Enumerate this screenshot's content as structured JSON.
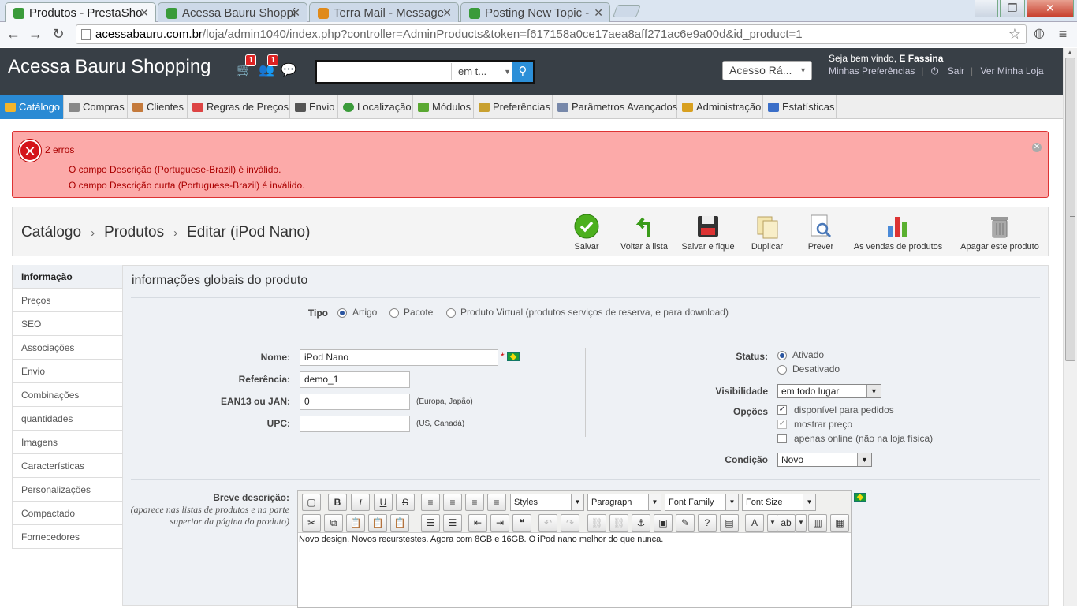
{
  "browser": {
    "tabs": [
      {
        "title": "Produtos - PrestaSho",
        "color": "#3a9b3a",
        "active": true
      },
      {
        "title": "Acessa Bauru Shoppi",
        "color": "#3a9b3a",
        "active": false
      },
      {
        "title": "Terra Mail - Message",
        "color": "#e08a1b",
        "active": false
      },
      {
        "title": "Posting New Topic -",
        "color": "#3a9b3a",
        "active": false
      }
    ],
    "url_host": "acessabauru.com.br",
    "url_path": "/loja/admin1040/index.php?controller=AdminProducts&token=f617158a0ce17aea8aff271ac6e9a00d&id_product=1"
  },
  "header": {
    "shop_name": "Acessa Bauru Shopping",
    "badges": {
      "orders": "1",
      "customers": "1"
    },
    "search_placeholder": "",
    "search_scope": "em t...",
    "quick_access": "Acesso Rá...",
    "welcome_prefix": "Seja bem vindo,",
    "user_name": "E Fassina",
    "links": {
      "prefs": "Minhas Preferências",
      "logout": "Sair",
      "view_shop": "Ver Minha Loja"
    }
  },
  "menu": [
    {
      "label": "Catálogo",
      "color": "#f3b52b"
    },
    {
      "label": "Compras",
      "color": "#777"
    },
    {
      "label": "Clientes",
      "color": "#c47a3c"
    },
    {
      "label": "Regras de Preços",
      "color": "#d44"
    },
    {
      "label": "Envio",
      "color": "#555"
    },
    {
      "label": "Localização",
      "color": "#3a9b3a"
    },
    {
      "label": "Módulos",
      "color": "#5aa832"
    },
    {
      "label": "Preferências",
      "color": "#c8a030"
    },
    {
      "label": "Parâmetros Avançados",
      "color": "#7788aa"
    },
    {
      "label": "Administração",
      "color": "#d8a020"
    },
    {
      "label": "Estatísticas",
      "color": "#3a6ec8"
    }
  ],
  "errors": {
    "count": "2 erros",
    "lines": [
      "O campo Descrição (Portuguese-Brazil) é inválido.",
      "O campo Descrição curta (Portuguese-Brazil) é inválido."
    ]
  },
  "breadcrumb": {
    "level1": "Catálogo",
    "level2": "Produtos",
    "level3": "Editar (iPod Nano)"
  },
  "toolbar": {
    "save": "Salvar",
    "back": "Voltar à lista",
    "save_stay": "Salvar e fique",
    "duplicate": "Duplicar",
    "preview": "Prever",
    "sales": "As vendas de produtos",
    "delete": "Apagar este produto"
  },
  "product_tabs": [
    "Informação",
    "Preços",
    "SEO",
    "Associações",
    "Envio",
    "Combinações",
    "quantidades",
    "Imagens",
    "Características",
    "Personalizações",
    "Compactado",
    "Fornecedores"
  ],
  "form": {
    "title": "informações globais do produto",
    "type_label": "Tipo",
    "type_options": [
      "Artigo",
      "Pacote",
      "Produto Virtual (produtos serviços de reserva, e para download)"
    ],
    "name_label": "Nome:",
    "name_value": "iPod Nano",
    "required_mark": "*",
    "ref_label": "Referência:",
    "ref_value": "demo_1",
    "ean_label": "EAN13 ou JAN:",
    "ean_value": "0",
    "ean_hint": "(Europa, Japão)",
    "upc_label": "UPC:",
    "upc_value": "",
    "upc_hint": "(US, Canadá)",
    "status_label": "Status:",
    "status_on": "Ativado",
    "status_off": "Desativado",
    "visibility_label": "Visibilidade",
    "visibility_value": "em todo lugar",
    "options_label": "Opções",
    "opt_available": "disponível para pedidos",
    "opt_show_price": "mostrar preço",
    "opt_online_only": "apenas online (não na loja física)",
    "condition_label": "Condição",
    "condition_value": "Novo",
    "short_desc_label": "Breve descrição:",
    "short_desc_sub": "(aparece nas listas de produtos e na parte superior da página do produto)",
    "editor": {
      "styles": "Styles",
      "paragraph": "Paragraph",
      "font_family": "Font Family",
      "font_size": "Font Size",
      "content": "Novo design. Novos recurstestes. Agora com 8GB e 16GB. O iPod nano melhor do que nunca."
    }
  }
}
